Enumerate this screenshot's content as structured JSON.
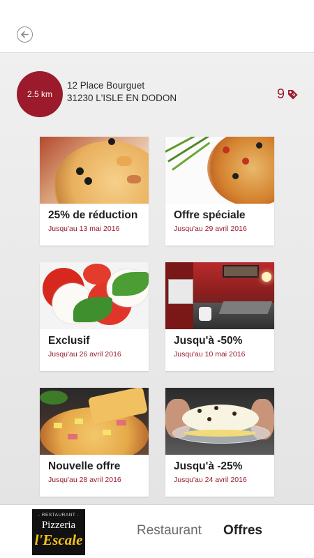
{
  "header": {
    "back_icon": "back-arrow-icon"
  },
  "info": {
    "distance": "2.5 km",
    "address_line1": "12 Place Bourguet",
    "address_line2": "31230 L'ISLE EN DODON",
    "offers_count": "9",
    "tag_icon": "price-tag-icon",
    "accent_color": "#9b1b2c"
  },
  "offers": [
    {
      "title": "25% de réduction",
      "date": "Jusqu'au 13 mai 2016",
      "image": "pizza-olives"
    },
    {
      "title": "Offre spéciale",
      "date": "Jusqu'au 29 avril 2016",
      "image": "pizza-herbs"
    },
    {
      "title": "Exclusif",
      "date": "Jusqu'au 26 avril 2016",
      "image": "caprese-salad"
    },
    {
      "title": "Jusqu'à -50%",
      "date": "Jusqu'au 10 mai 2016",
      "image": "restaurant-interior"
    },
    {
      "title": "Nouvelle offre",
      "date": "Jusqu'au 28 avril 2016",
      "image": "pizza-pineapple"
    },
    {
      "title": "Jusqu'à -25%",
      "date": "Jusqu'au 24 avril 2016",
      "image": "dessert-banana-split"
    }
  ],
  "footer": {
    "logo_line1": "- RESTAURANT -",
    "logo_line2": "Pizzeria",
    "logo_line3": "l'Escale",
    "tab_restaurant": "Restaurant",
    "tab_offres": "Offres"
  }
}
